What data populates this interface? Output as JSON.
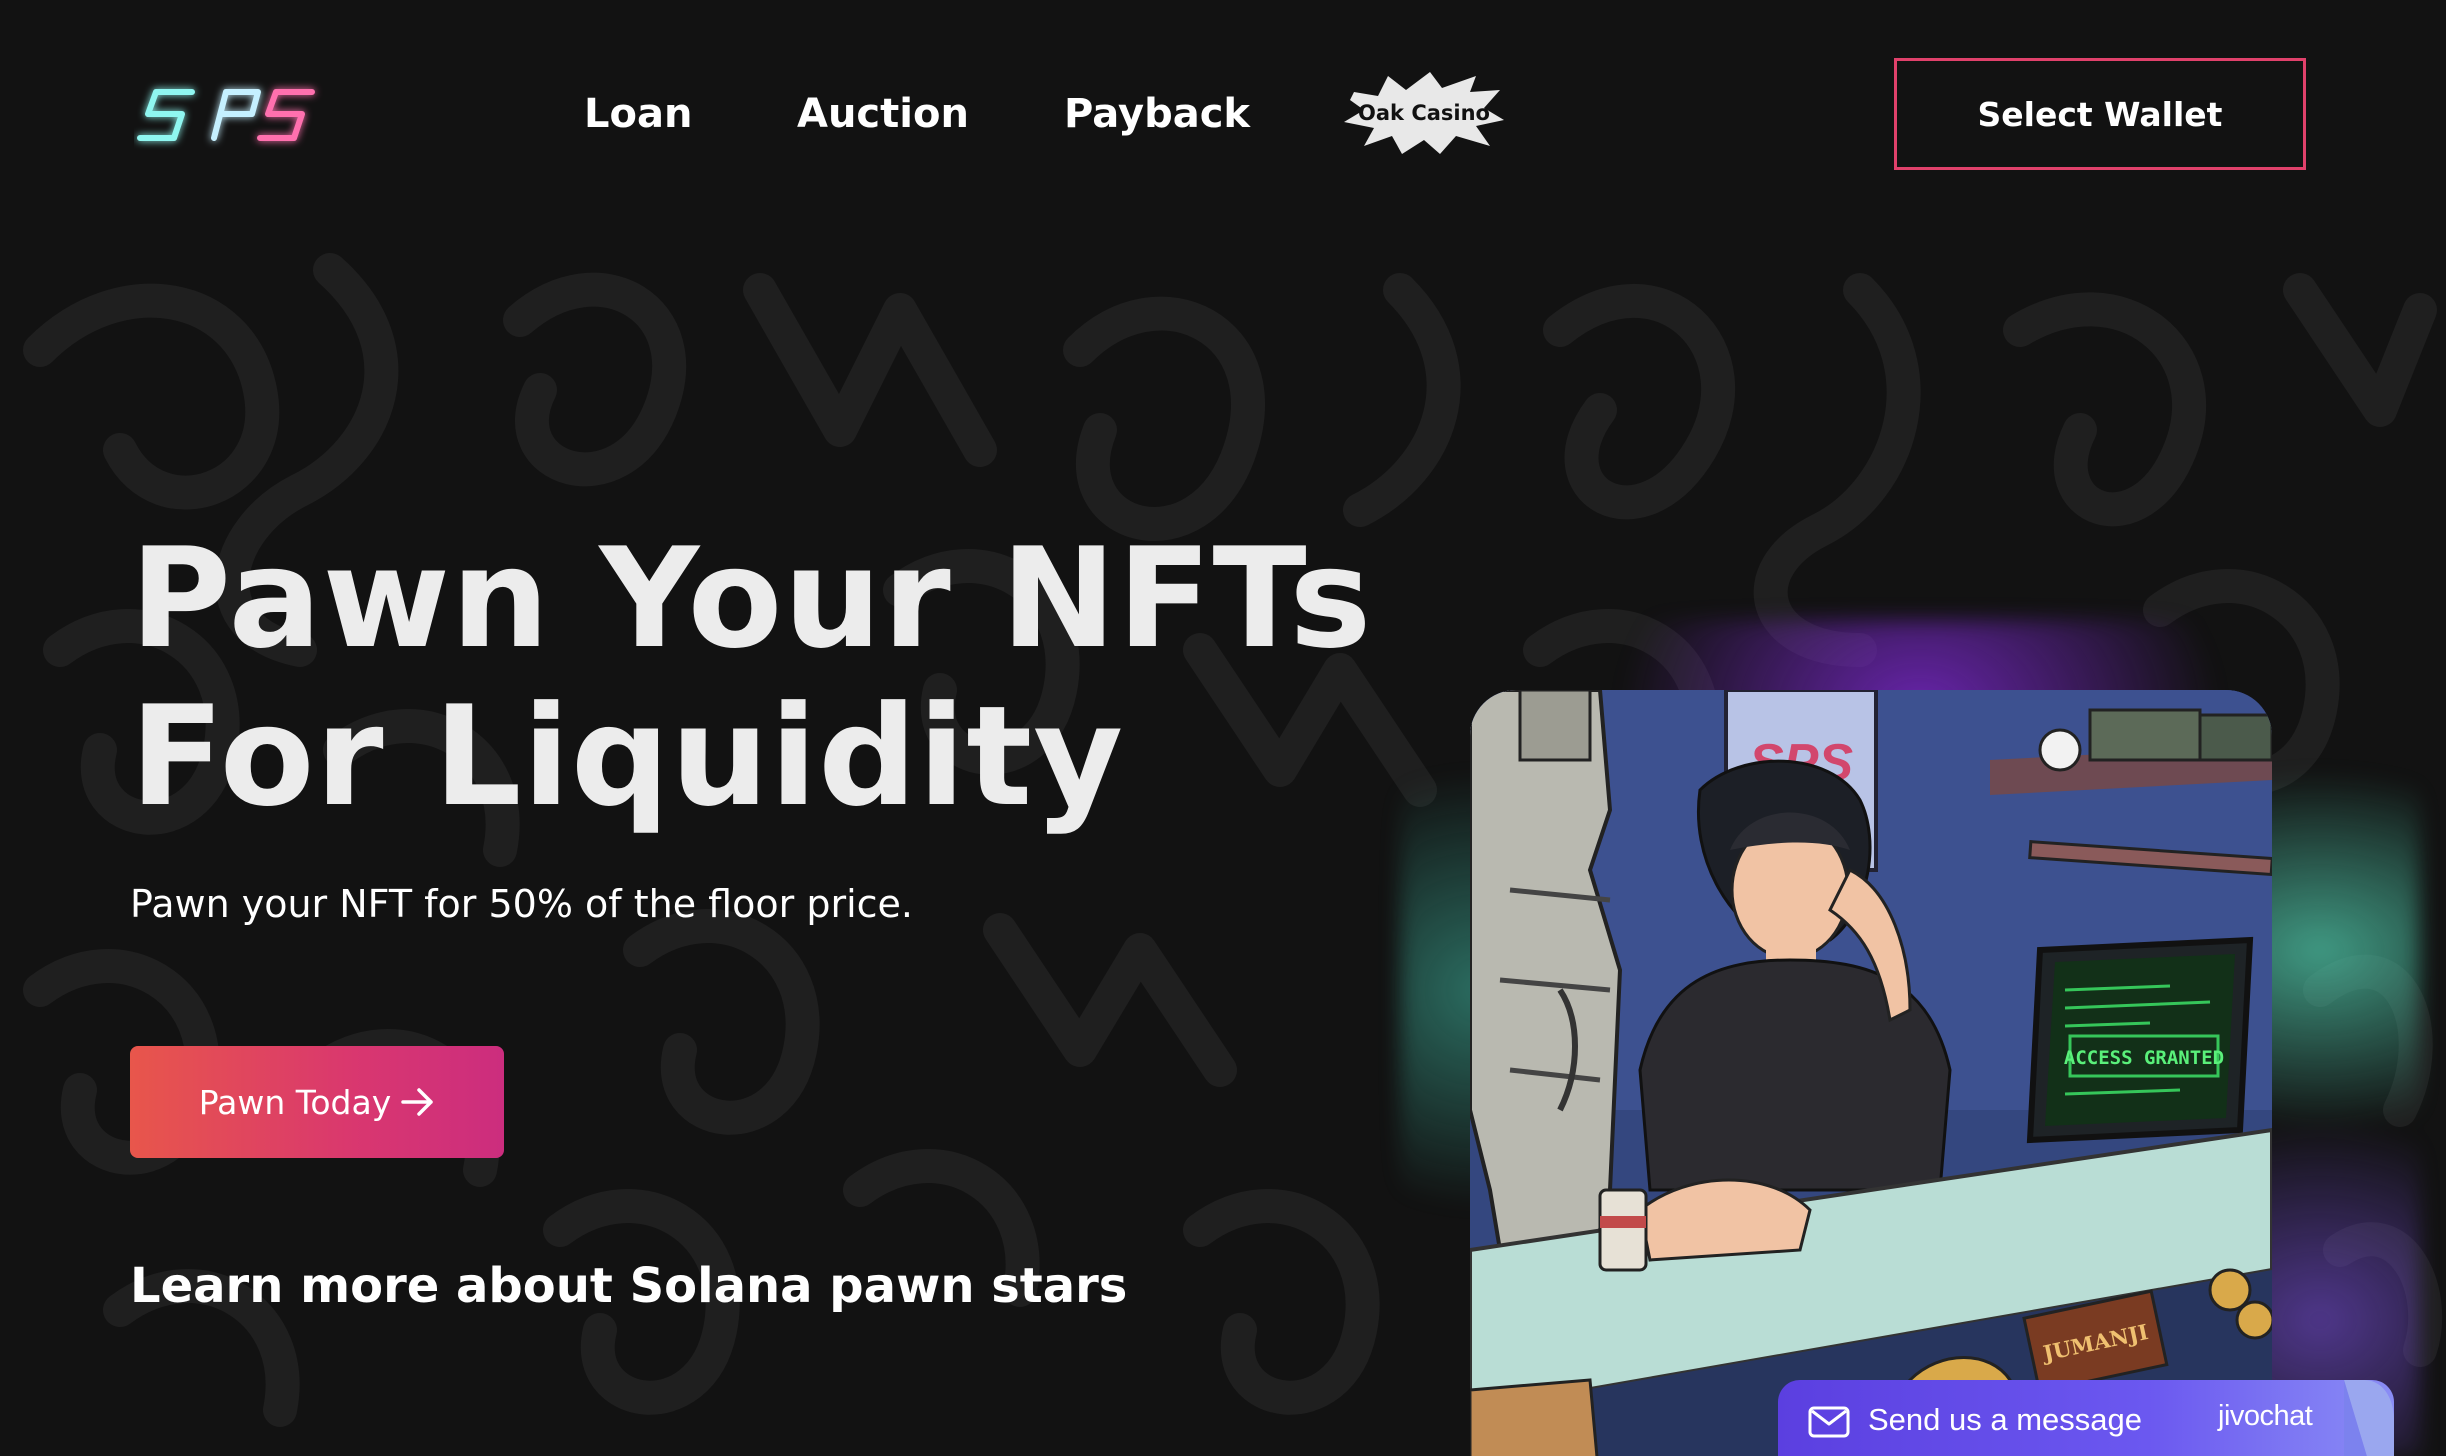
{
  "header": {
    "logo_text": "SPS",
    "nav": {
      "loan": "Loan",
      "auction": "Auction",
      "payback": "Payback"
    },
    "oak_casino": "Oak Casino",
    "select_wallet": "Select Wallet"
  },
  "hero": {
    "title_line1": "Pawn Your NFTs",
    "title_line2": "For Liquidity",
    "subtitle": "Pawn your NFT for 50% of the floor price.",
    "cta_label": "Pawn Today",
    "learn_more": "Learn more about Solana pawn stars"
  },
  "illustration": {
    "poster_text": "SPS",
    "monitor_text": "ACCESS GRANTED",
    "box_text": "JUMANJI"
  },
  "chat_widget": {
    "label": "Send us a message",
    "brand": "jivochat"
  },
  "colors": {
    "background": "#121212",
    "accent_border": "#e0416b",
    "cta_gradient_start": "#e8564b",
    "cta_gradient_end": "#cc2d7e",
    "chat_purple": "#5b3fe0"
  },
  "icons": [
    "arrow-right-icon",
    "envelope-icon"
  ]
}
